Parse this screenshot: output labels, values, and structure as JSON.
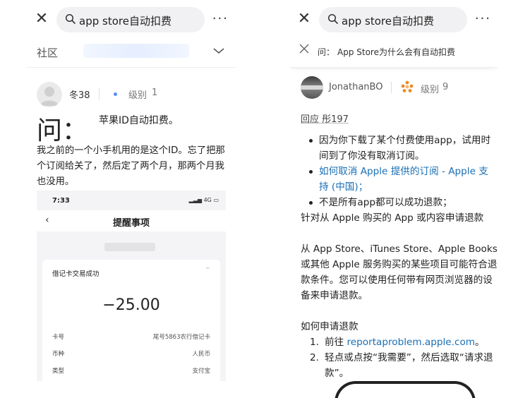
{
  "left": {
    "search_query": "app store自动扣费",
    "more_label": "···",
    "category": "社区",
    "author": "冬38",
    "level_label": "级别",
    "level_value": "1",
    "question_mark": "问：",
    "question_title": "苹果ID自动扣费。",
    "question_body": "我之前的一个小手机用的是这个ID。忘了把那个订阅给关了，然后定了两个月，那两个月我也没用。",
    "screenshot": {
      "time": "7:33",
      "signal": "4G",
      "nav_title": "提醒事项",
      "card_title": "借记卡交易成功",
      "amount": "−25.00",
      "rows": [
        {
          "label": "卡号",
          "value": "尾号5863农行借记卡"
        },
        {
          "label": "币种",
          "value": "人民币"
        },
        {
          "label": "类型",
          "value": "支付宝"
        }
      ]
    }
  },
  "right": {
    "search_query": "app store自动扣费",
    "more_label": "···",
    "question_prefix": "问：",
    "question_title": "App Store为什么会有自动扣费",
    "author": "JonathanBO",
    "level_label": "级别",
    "level_value": "9",
    "reply_to": "回应 彤197",
    "bullets": [
      "因为你下载了某个付费使用app，试用时间到了你没有取消订阅。",
      "如何取消 Apple 提供的订阅 - Apple 支持 (中国)；",
      "不是所有app都可以成功退款；"
    ],
    "para1": "针对从 Apple 购买的 App 或内容申请退款",
    "para2": "从 App Store、iTunes Store、Apple Books 或其他 Apple 服务购买的某些项目可能符合退款条件。您可以使用任何带有网页浏览器的设备来申请退款。",
    "howto_title": "如何申请退款",
    "steps": [
      {
        "num": "1.",
        "prefix": "前往 ",
        "link": "reportaproblem.apple.com",
        "suffix": "。"
      },
      {
        "num": "2.",
        "text": "轻点或点按“我需要”，然后选取“请求退款”。"
      }
    ]
  },
  "colors": {
    "link": "#1a6fb5",
    "search_bg": "#f1f1f3",
    "accent_blue_dot": "#5b8def",
    "badge_orange": "#f08a24"
  },
  "icons": [
    "close-icon",
    "search-icon",
    "more-icon",
    "chevron-down-icon",
    "avatar",
    "level-badge-icon"
  ]
}
